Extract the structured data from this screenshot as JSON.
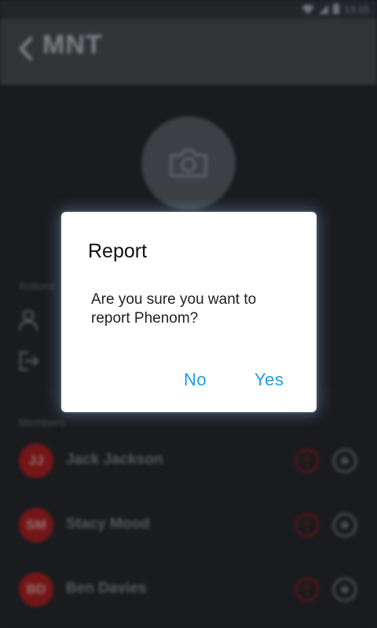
{
  "status_bar": {
    "time": "13:15",
    "icons": [
      "wifi-icon",
      "signal-icon",
      "battery-icon"
    ]
  },
  "toolbar": {
    "back_icon": "chevron-left-icon",
    "title": "MNT"
  },
  "group": {
    "photo_icon": "camera-icon"
  },
  "actions": {
    "header": "Actions",
    "items": [
      {
        "icon": "person-icon",
        "label": ""
      },
      {
        "icon": "exit-icon",
        "label": ""
      }
    ]
  },
  "members": {
    "header": "Members",
    "items": [
      {
        "initials": "JJ",
        "name": "Jack Jackson"
      },
      {
        "initials": "SM",
        "name": "Stacy Mood"
      },
      {
        "initials": "BD",
        "name": "Ben Davies"
      }
    ]
  },
  "dialog": {
    "title": "Report",
    "message": "Are you sure you want to report Phenom?",
    "negative_label": "No",
    "positive_label": "Yes"
  },
  "colors": {
    "accent": "#1a9ee6",
    "avatar_red": "#8e1c1e",
    "toolbar": "#3c3f44",
    "background": "#1f2125"
  }
}
